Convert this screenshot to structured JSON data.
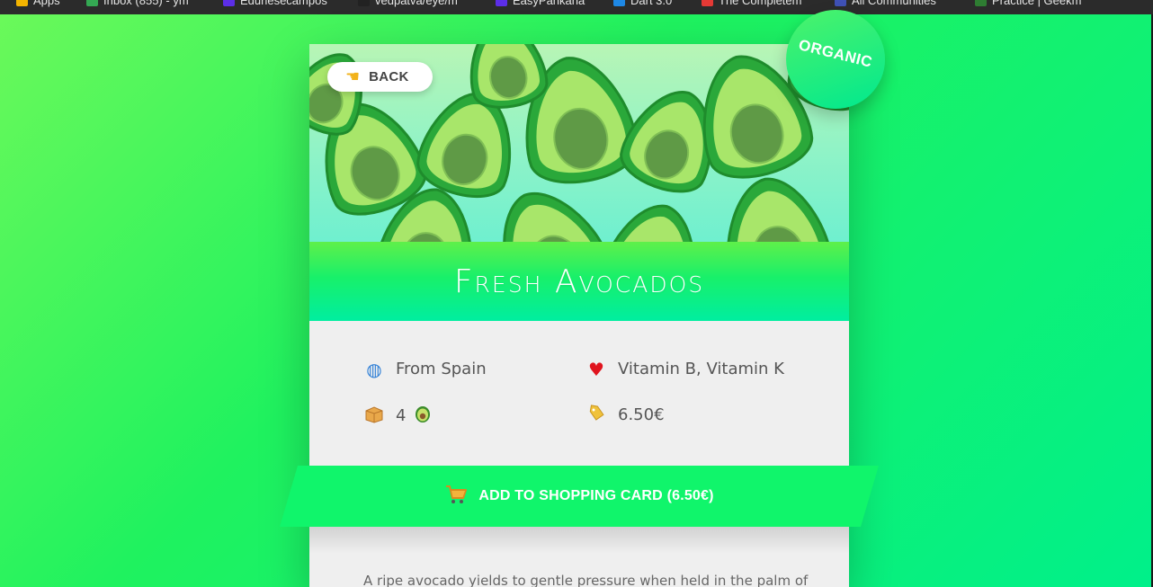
{
  "bookmarks": [
    {
      "label": "Apps",
      "color": "#f4b400"
    },
    {
      "label": "Inbox (855) - ym",
      "color": "#34a853"
    },
    {
      "label": "Edurlesecampos",
      "color": "#5c2ee8"
    },
    {
      "label": "vedpatva/eye/m",
      "color": "#222222"
    },
    {
      "label": "EasyPankaha",
      "color": "#5c2ee8"
    },
    {
      "label": "Dart 3.0",
      "color": "#1e88e5"
    },
    {
      "label": "The Completem",
      "color": "#e53935"
    },
    {
      "label": "All Communities",
      "color": "#3f51b5"
    },
    {
      "label": "Practice | Geekm",
      "color": "#2e7d32"
    }
  ],
  "product": {
    "title": "Fresh Avocados",
    "badge": "ORGANIC",
    "back_label": "BACK",
    "back_icon": "pointing-hand-icon",
    "origin": "From Spain",
    "vitamins": "Vitamin B, Vitamin K",
    "quantity": "4",
    "price": "6.50€",
    "cta_label": "ADD TO SHOPPING CARD (6.50€)",
    "description": "A ripe avocado yields to gentle pressure when held in the palm of"
  },
  "icons": {
    "origin": "globe-icon",
    "vitamins": "heart-icon",
    "quantity": "package-icon",
    "price": "price-tag-icon",
    "cart": "shopping-cart-icon",
    "avocado": "avocado-icon"
  },
  "colors": {
    "accent": "#10f56b",
    "background_start": "#6cf95a",
    "background_end": "#00f08a",
    "card": "#efefef"
  }
}
